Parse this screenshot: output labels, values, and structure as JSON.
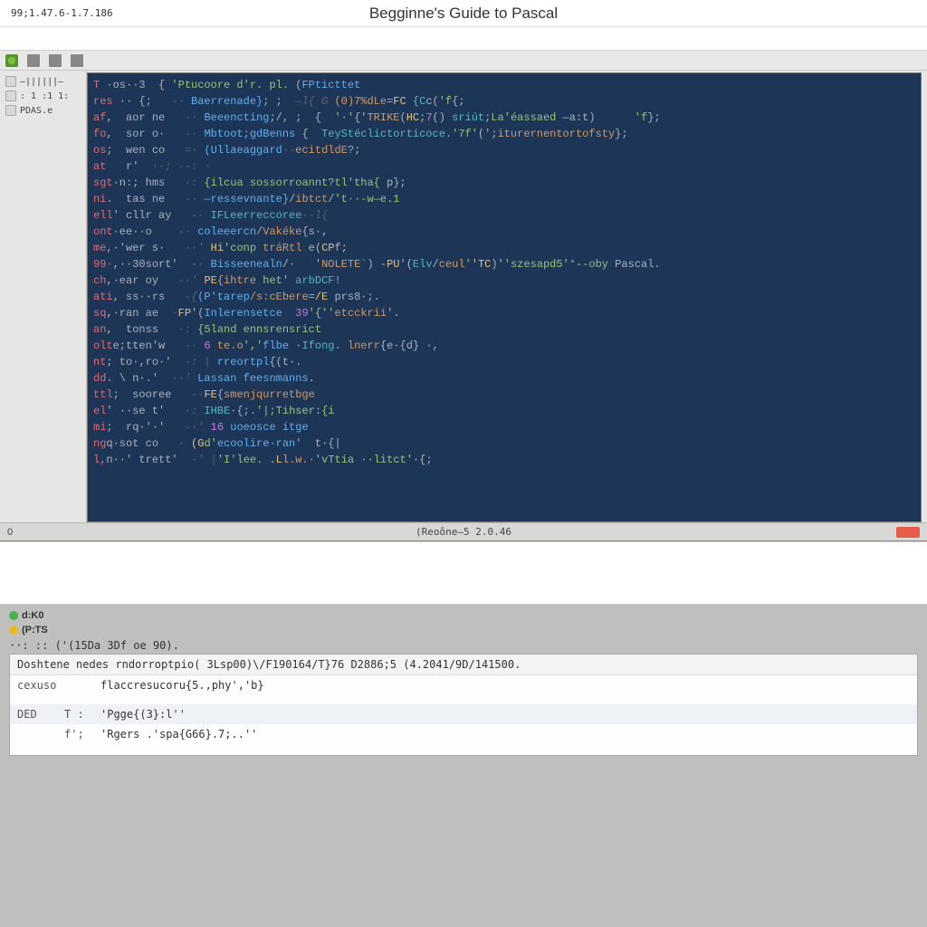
{
  "header": {
    "timestamp": "99;1.47.6-1.7.186",
    "title": "Begginne's Guide to Pascal"
  },
  "toolbar": {
    "icons": [
      "home",
      "new",
      "save",
      "run"
    ]
  },
  "sidebar": {
    "items": [
      {
        "label": "—||||||—"
      },
      {
        "label": ": 1 :1 1:"
      },
      {
        "label": "PDAS.e"
      }
    ]
  },
  "editor": {
    "lines": [
      {
        "segments": [
          {
            "t": "T",
            "c": "kw"
          },
          {
            "t": " ·os··3  { ",
            "c": "pl"
          },
          {
            "t": "'Ptucoore d'r. pl.",
            "c": "st"
          },
          {
            "t": " (",
            "c": "pl"
          },
          {
            "t": "FPticttet",
            "c": "fn"
          }
        ]
      },
      {
        "segments": [
          {
            "t": "res",
            "c": "kw"
          },
          {
            "t": " ·· {;   ",
            "c": "pl"
          },
          {
            "t": "-· ",
            "c": "cm"
          },
          {
            "t": "Baerrenade}",
            "c": "fn"
          },
          {
            "t": "; ;  ",
            "c": "pl"
          },
          {
            "t": "—l{ G ",
            "c": "cm"
          },
          {
            "t": "(0)7%dLe",
            "c": "id"
          },
          {
            "t": "=",
            "c": "pl"
          },
          {
            "t": "FC",
            "c": "hl"
          },
          {
            "t": " ",
            "c": "pl"
          },
          {
            "t": "{C",
            "c": "ty"
          },
          {
            "t": "c(",
            "c": "pl"
          },
          {
            "t": "'f",
            "c": "st"
          },
          {
            "t": "{;",
            "c": "pl"
          }
        ]
      },
      {
        "segments": [
          {
            "t": "af",
            "c": "kw"
          },
          {
            "t": ",  aor ne   ",
            "c": "pl"
          },
          {
            "t": "-· ",
            "c": "cm"
          },
          {
            "t": "Beeencting",
            "c": "fn"
          },
          {
            "t": ";/, ;  {  ",
            "c": "pl"
          },
          {
            "t": "'·'",
            "c": "st"
          },
          {
            "t": "{'",
            "c": "pl"
          },
          {
            "t": "TRIKE",
            "c": "id"
          },
          {
            "t": "(",
            "c": "pl"
          },
          {
            "t": "HC",
            "c": "hl"
          },
          {
            "t": ";",
            "c": "pl"
          },
          {
            "t": "7",
            "c": "nm"
          },
          {
            "t": "() ",
            "c": "pl"
          },
          {
            "t": "sriút",
            "c": "ty"
          },
          {
            "t": ";",
            "c": "pl"
          },
          {
            "t": "La'éassaed",
            "c": "st"
          },
          {
            "t": " —a:t)      ",
            "c": "pl"
          },
          {
            "t": "'f",
            "c": "st"
          },
          {
            "t": "};",
            "c": "pl"
          }
        ]
      },
      {
        "segments": [
          {
            "t": "fo",
            "c": "kw"
          },
          {
            "t": ",  sor o·   ",
            "c": "pl"
          },
          {
            "t": "-· ",
            "c": "cm"
          },
          {
            "t": "Mbtoot;gdBenns",
            "c": "fn"
          },
          {
            "t": " {  ",
            "c": "pl"
          },
          {
            "t": "TeyStéclictorticoce",
            "c": "ty"
          },
          {
            "t": ".",
            "c": "pl"
          },
          {
            "t": "'7f'",
            "c": "st"
          },
          {
            "t": "(';",
            "c": "pl"
          },
          {
            "t": "iturernentortofsty",
            "c": "id"
          },
          {
            "t": "};",
            "c": "pl"
          }
        ]
      },
      {
        "segments": [
          {
            "t": "os",
            "c": "kw"
          },
          {
            "t": ";  wen co   ",
            "c": "pl"
          },
          {
            "t": "=· ",
            "c": "cm"
          },
          {
            "t": "(Ullaeaggard",
            "c": "fn"
          },
          {
            "t": "--",
            "c": "cm"
          },
          {
            "t": "ecitdldE",
            "c": "id"
          },
          {
            "t": "?;",
            "c": "pl"
          }
        ]
      },
      {
        "segments": [
          {
            "t": "at",
            "c": "kw"
          },
          {
            "t": "   r'  ",
            "c": "pl"
          },
          {
            "t": "··; ",
            "c": "cm"
          },
          {
            "t": "--: ·",
            "c": "cm"
          }
        ]
      },
      {
        "segments": [
          {
            "t": "sgt",
            "c": "kw"
          },
          {
            "t": "·n:; hms   ",
            "c": "pl"
          },
          {
            "t": "·: ",
            "c": "cm"
          },
          {
            "t": "{ilcua sossorroannt?tl'tha{",
            "c": "st"
          },
          {
            "t": " p};",
            "c": "pl"
          }
        ]
      },
      {
        "segments": [
          {
            "t": "ni",
            "c": "kw"
          },
          {
            "t": ".  tas ne   ",
            "c": "pl"
          },
          {
            "t": "-· ",
            "c": "cm"
          },
          {
            "t": "—ressevnante}",
            "c": "fn"
          },
          {
            "t": "/",
            "c": "pl"
          },
          {
            "t": "ibtct",
            "c": "id"
          },
          {
            "t": "/",
            "c": "pl"
          },
          {
            "t": "'t··-w—e.1",
            "c": "st"
          }
        ]
      },
      {
        "segments": [
          {
            "t": "ell",
            "c": "kw"
          },
          {
            "t": "' cllr ay   ",
            "c": "pl"
          },
          {
            "t": "-· ",
            "c": "cm"
          },
          {
            "t": "IFLeerreccoree",
            "c": "ty"
          },
          {
            "t": "--l{",
            "c": "cm"
          }
        ]
      },
      {
        "segments": [
          {
            "t": "ont",
            "c": "kw"
          },
          {
            "t": "·ee··o    ",
            "c": "pl"
          },
          {
            "t": "-· ",
            "c": "cm"
          },
          {
            "t": "coleeercn",
            "c": "fn"
          },
          {
            "t": "/",
            "c": "pl"
          },
          {
            "t": "Vakéke",
            "c": "id"
          },
          {
            "t": "{s·,",
            "c": "pl"
          }
        ]
      },
      {
        "segments": [
          {
            "t": "me",
            "c": "kw"
          },
          {
            "t": ",·'wer s·   ",
            "c": "pl"
          },
          {
            "t": "··' ",
            "c": "cm"
          },
          {
            "t": "Hi",
            "c": "hl"
          },
          {
            "t": "'conp ",
            "c": "st"
          },
          {
            "t": "tráRtl",
            "c": "id"
          },
          {
            "t": " e(",
            "c": "pl"
          },
          {
            "t": "CP",
            "c": "hl"
          },
          {
            "t": "f;",
            "c": "pl"
          }
        ]
      },
      {
        "segments": [
          {
            "t": "99·",
            "c": "kw"
          },
          {
            "t": ",··30sort'  ",
            "c": "pl"
          },
          {
            "t": "-· ",
            "c": "cm"
          },
          {
            "t": "Bisseenealn",
            "c": "fn"
          },
          {
            "t": "/·   ",
            "c": "pl"
          },
          {
            "t": "'",
            "c": "st"
          },
          {
            "t": "NOLETE",
            "c": "id"
          },
          {
            "t": "`) -",
            "c": "pl"
          },
          {
            "t": "PU",
            "c": "hl"
          },
          {
            "t": "'(",
            "c": "pl"
          },
          {
            "t": "Elv",
            "c": "ty"
          },
          {
            "t": "/",
            "c": "pl"
          },
          {
            "t": "ceul",
            "c": "id"
          },
          {
            "t": "'",
            "c": "st"
          },
          {
            "t": "'TC",
            "c": "hl"
          },
          {
            "t": ")'",
            "c": "pl"
          },
          {
            "t": "'szesapd5'°--oby",
            "c": "st"
          },
          {
            "t": " Pascal.",
            "c": "pl"
          }
        ]
      },
      {
        "segments": [
          {
            "t": "ch",
            "c": "kw"
          },
          {
            "t": ",·ear oy   ",
            "c": "pl"
          },
          {
            "t": "-·' ",
            "c": "cm"
          },
          {
            "t": "PE",
            "c": "hl"
          },
          {
            "t": "{ihtre",
            "c": "id"
          },
          {
            "t": " het'",
            "c": "st"
          },
          {
            "t": " arbDCF",
            "c": "ty"
          },
          {
            "t": "!",
            "c": "pl"
          }
        ]
      },
      {
        "segments": [
          {
            "t": "ati",
            "c": "kw"
          },
          {
            "t": ", ss··rs   ",
            "c": "pl"
          },
          {
            "t": "-{",
            "c": "cm"
          },
          {
            "t": "(P'tarep",
            "c": "fn"
          },
          {
            "t": "/s:cEbere",
            "c": "id"
          },
          {
            "t": "=",
            "c": "pl"
          },
          {
            "t": "/E",
            "c": "hl"
          },
          {
            "t": " prs8·;.",
            "c": "pl"
          }
        ]
      },
      {
        "segments": [
          {
            "t": "sq",
            "c": "kw"
          },
          {
            "t": ",·ran ae  ",
            "c": "pl"
          },
          {
            "t": "·",
            "c": "cm"
          },
          {
            "t": "FP",
            "c": "hl"
          },
          {
            "t": "'(",
            "c": "pl"
          },
          {
            "t": "Inlerensetce",
            "c": "fn"
          },
          {
            "t": "  ",
            "c": "pl"
          },
          {
            "t": "39",
            "c": "nm"
          },
          {
            "t": "'{'",
            "c": "st"
          },
          {
            "t": "'etcckrii",
            "c": "id"
          },
          {
            "t": "'.",
            "c": "pl"
          }
        ]
      },
      {
        "segments": [
          {
            "t": "an",
            "c": "kw"
          },
          {
            "t": ",  tonss   ",
            "c": "pl"
          },
          {
            "t": "·: ",
            "c": "cm"
          },
          {
            "t": "{5land ennsrensrict",
            "c": "st"
          }
        ]
      },
      {
        "segments": [
          {
            "t": "olt",
            "c": "kw"
          },
          {
            "t": "e;tten'w   ",
            "c": "pl"
          },
          {
            "t": "-· ",
            "c": "cm"
          },
          {
            "t": "6",
            "c": "nm"
          },
          {
            "t": " ",
            "c": "pl"
          },
          {
            "t": "te.o",
            "c": "id"
          },
          {
            "t": "','",
            "c": "st"
          },
          {
            "t": "flbe",
            "c": "fn"
          },
          {
            "t": " ·",
            "c": "pl"
          },
          {
            "t": "Ifong",
            "c": "ty"
          },
          {
            "t": ". ",
            "c": "pl"
          },
          {
            "t": "lnerr",
            "c": "id"
          },
          {
            "t": "{e·{d} ·,",
            "c": "pl"
          }
        ]
      },
      {
        "segments": [
          {
            "t": "nt",
            "c": "kw"
          },
          {
            "t": "; to·,ro·'  ",
            "c": "pl"
          },
          {
            "t": "·: | ",
            "c": "cm"
          },
          {
            "t": "rreortpl",
            "c": "fn"
          },
          {
            "t": "{(t·.",
            "c": "pl"
          }
        ]
      },
      {
        "segments": [
          {
            "t": "dd",
            "c": "kw"
          },
          {
            "t": ". \\ n·.'  ",
            "c": "pl"
          },
          {
            "t": "··' ",
            "c": "cm"
          },
          {
            "t": "Lassan feesnmanns",
            "c": "fn"
          },
          {
            "t": ".",
            "c": "pl"
          }
        ]
      },
      {
        "segments": [
          {
            "t": "ttl",
            "c": "kw"
          },
          {
            "t": ";  sooree   ",
            "c": "pl"
          },
          {
            "t": "-·",
            "c": "cm"
          },
          {
            "t": "FE",
            "c": "hl"
          },
          {
            "t": "{",
            "c": "pl"
          },
          {
            "t": "smenjqurretbge",
            "c": "id"
          }
        ]
      },
      {
        "segments": [
          {
            "t": "el",
            "c": "kw"
          },
          {
            "t": "' ··se t'   ",
            "c": "pl"
          },
          {
            "t": "·: ",
            "c": "cm"
          },
          {
            "t": "IHBE",
            "c": "ty"
          },
          {
            "t": "·{;.",
            "c": "pl"
          },
          {
            "t": "'|;Tihser:{i",
            "c": "st"
          }
        ]
      },
      {
        "segments": [
          {
            "t": "mi",
            "c": "kw"
          },
          {
            "t": ";  rq·'·'   ",
            "c": "pl"
          },
          {
            "t": "-·' ",
            "c": "cm"
          },
          {
            "t": "16",
            "c": "nm"
          },
          {
            "t": " ",
            "c": "pl"
          },
          {
            "t": "uoeosce itge",
            "c": "fn"
          }
        ]
      },
      {
        "segments": [
          {
            "t": "ng",
            "c": "kw"
          },
          {
            "t": "q·sot co   ",
            "c": "pl"
          },
          {
            "t": "· ",
            "c": "cm"
          },
          {
            "t": "(G",
            "c": "hl"
          },
          {
            "t": "d'",
            "c": "st"
          },
          {
            "t": "ecoolire·ran",
            "c": "fn"
          },
          {
            "t": "'",
            "c": "st"
          },
          {
            "t": "  t·{|",
            "c": "pl"
          }
        ]
      },
      {
        "segments": [
          {
            "t": "l,",
            "c": "kw"
          },
          {
            "t": "n··' trett'  ",
            "c": "pl"
          },
          {
            "t": "·' |",
            "c": "cm"
          },
          {
            "t": "'I'lee",
            "c": "st"
          },
          {
            "t": ". .",
            "c": "pl"
          },
          {
            "t": "L",
            "c": "hl"
          },
          {
            "t": "l.w.·",
            "c": "id"
          },
          {
            "t": "'vTtia ··litct'",
            "c": "st"
          },
          {
            "t": "·{;",
            "c": "pl"
          }
        ]
      }
    ]
  },
  "status_bar": {
    "left_marker": "0",
    "center": "(Reoône—5 2.0.46"
  },
  "console": {
    "chip_a": "d:K0",
    "chip_b": "(P:TS",
    "meta": "··: ::  ('(15Da  3Df oe  90).",
    "header": "Doshtene nedes rndorroptpio( 3Lsp00)\\/F190164/T}76   D2886;5  (4.2041/9D/141500.",
    "rows": [
      {
        "label": "cexuso",
        "sub": "",
        "body": "flaccresucoru{5.,phy','b}"
      },
      {
        "label": "DED",
        "sub": "T :",
        "body": "'Pgge{(3}:l''"
      },
      {
        "label": "",
        "sub": "f';",
        "body": "'Rgers .'spa{G66}.7;..''"
      }
    ]
  }
}
